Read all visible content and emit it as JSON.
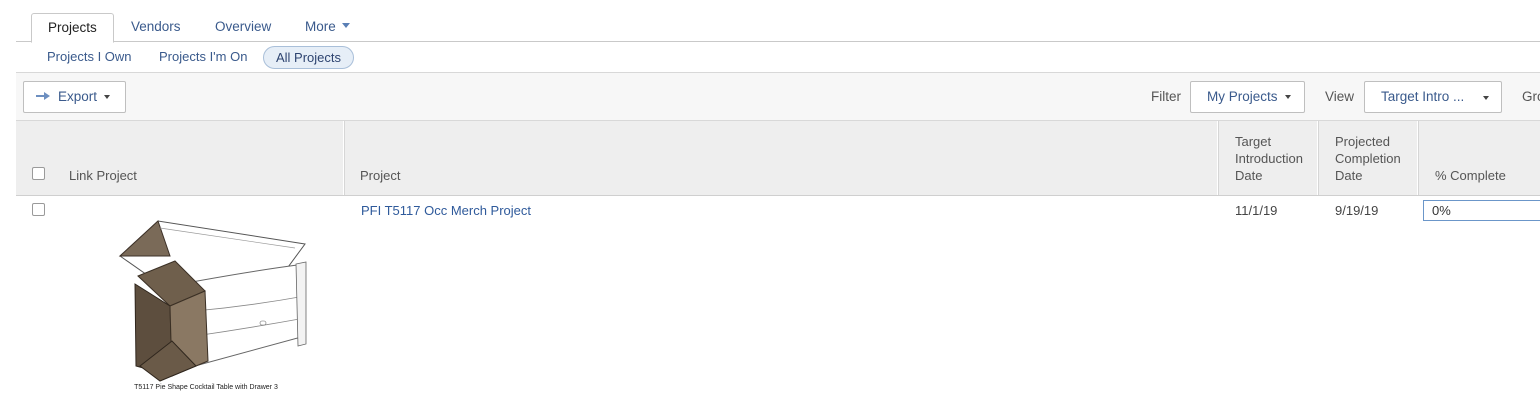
{
  "tabs": [
    "Projects",
    "Vendors",
    "Overview",
    "More"
  ],
  "subtabs": [
    "Projects I Own",
    "Projects I'm On",
    "All Projects"
  ],
  "toolbar": {
    "export_label": "Export",
    "filter_label": "Filter",
    "filter_value": "My Projects",
    "view_label": "View",
    "view_value": "Target Intro ...",
    "group_label_partial": "Gro"
  },
  "columns": {
    "link_project": "Link Project",
    "project": "Project",
    "target_intro": [
      "Target",
      "Introduction",
      "Date"
    ],
    "projected_completion": [
      "Projected",
      "Completion",
      "Date"
    ],
    "percent_complete": "% Complete"
  },
  "rows": [
    {
      "project": "PFI T5117 Occ Merch Project",
      "target_intro_date": "11/1/19",
      "projected_completion_date": "9/19/19",
      "percent_complete": "0%",
      "image_caption": "T5117 Pie Shape Cocktail Table with Drawer 3"
    }
  ],
  "colors": {
    "link": "#2f5a9b",
    "active_pill_bg": "#e6eef7",
    "header_bg": "#eeeeee"
  }
}
